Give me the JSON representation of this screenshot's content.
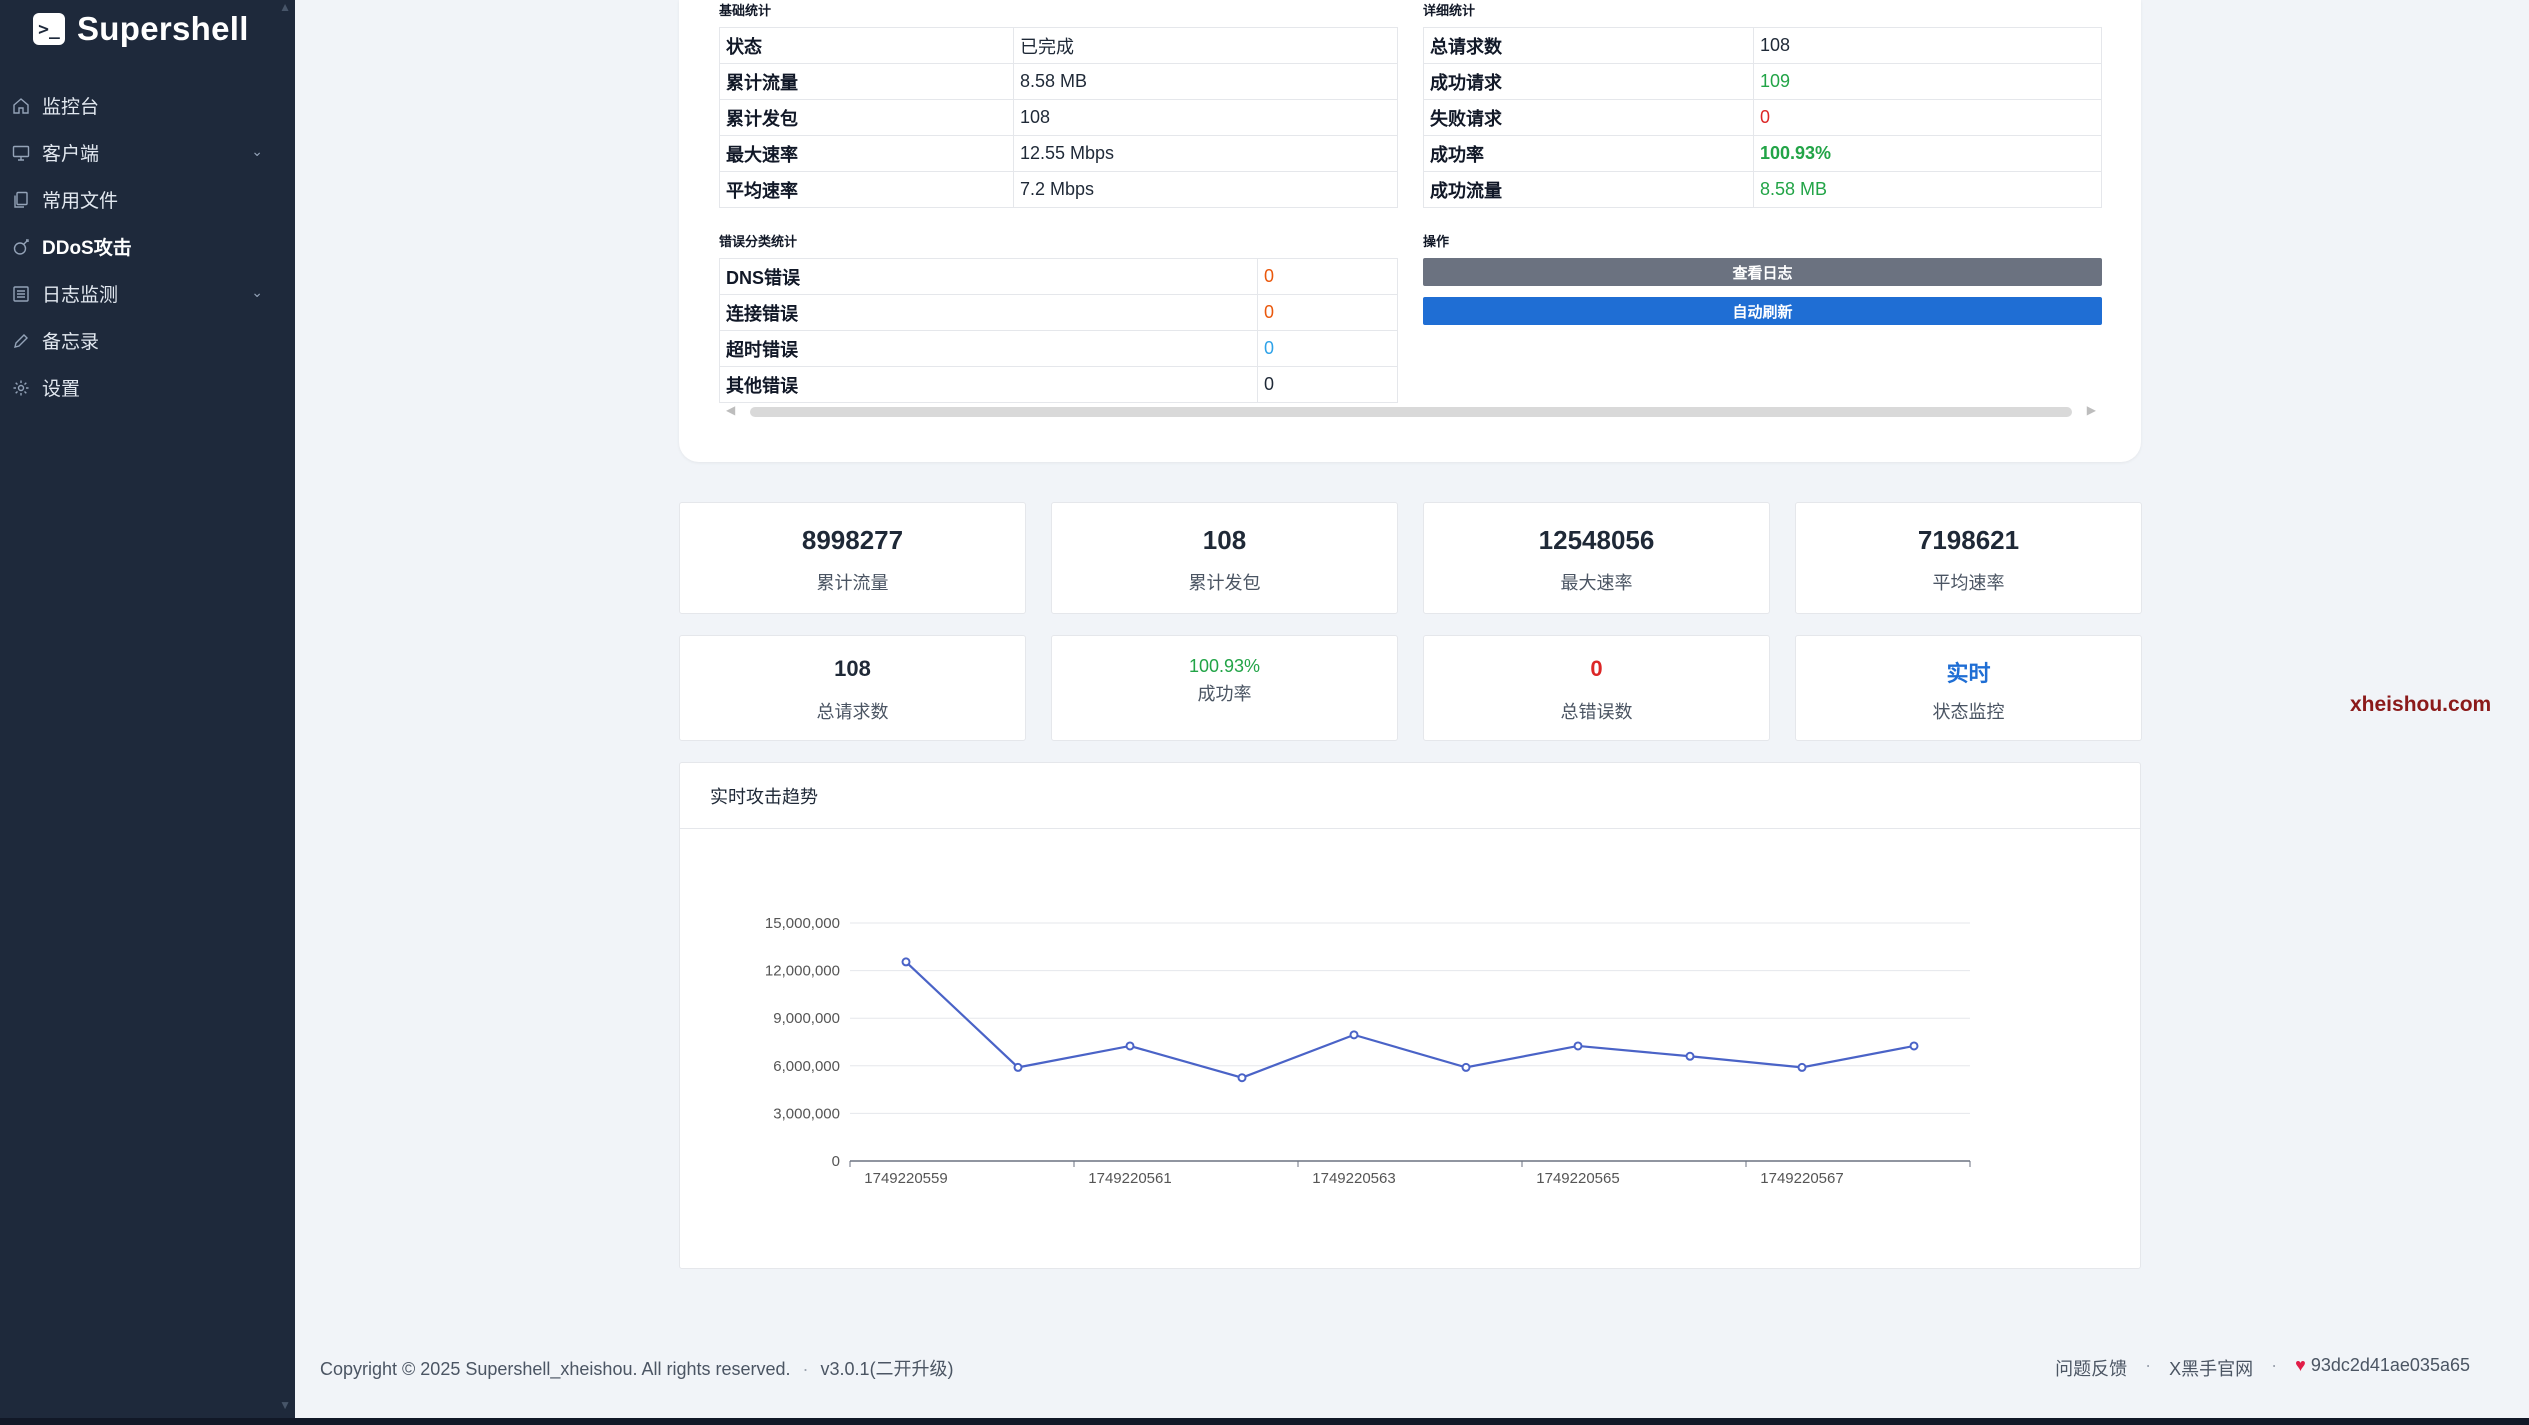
{
  "brand": {
    "name": "Supershell",
    "logo_glyph": ">_"
  },
  "sidebar": {
    "items": [
      {
        "label": "监控台",
        "icon": "home-icon",
        "has_chevron": false,
        "active": false
      },
      {
        "label": "客户端",
        "icon": "monitor-icon",
        "has_chevron": true,
        "active": false
      },
      {
        "label": "常用文件",
        "icon": "files-icon",
        "has_chevron": false,
        "active": false
      },
      {
        "label": "DDoS攻击",
        "icon": "bomb-icon",
        "has_chevron": false,
        "active": true
      },
      {
        "label": "日志监测",
        "icon": "list-icon",
        "has_chevron": true,
        "active": false
      },
      {
        "label": "备忘录",
        "icon": "pencil-icon",
        "has_chevron": false,
        "active": false
      },
      {
        "label": "设置",
        "icon": "gear-icon",
        "has_chevron": false,
        "active": false
      }
    ]
  },
  "basic_stats": {
    "title": "基础统计",
    "rows": [
      {
        "k": "状态",
        "v": "已完成"
      },
      {
        "k": "累计流量",
        "v": "8.58 MB"
      },
      {
        "k": "累计发包",
        "v": "108"
      },
      {
        "k": "最大速率",
        "v": "12.55 Mbps"
      },
      {
        "k": "平均速率",
        "v": "7.2 Mbps"
      }
    ]
  },
  "detail_stats": {
    "title": "详细统计",
    "rows": [
      {
        "k": "总请求数",
        "v": "108"
      },
      {
        "k": "成功请求",
        "v": "109"
      },
      {
        "k": "失败请求",
        "v": "0"
      },
      {
        "k": "成功率",
        "v": "100.93%"
      },
      {
        "k": "成功流量",
        "v": "8.58 MB"
      }
    ]
  },
  "error_stats": {
    "title": "错误分类统计",
    "rows": [
      {
        "k": "DNS错误",
        "v": "0"
      },
      {
        "k": "连接错误",
        "v": "0"
      },
      {
        "k": "超时错误",
        "v": "0"
      },
      {
        "k": "其他错误",
        "v": "0"
      }
    ]
  },
  "actions": {
    "title": "操作",
    "view_log": "查看日志",
    "auto_refresh": "自动刷新",
    "view_log_color": "#6b7280",
    "auto_refresh_color": "#1f6ed4"
  },
  "stat_cards_row1": [
    {
      "value": "8998277",
      "label": "累计流量"
    },
    {
      "value": "108",
      "label": "累计发包"
    },
    {
      "value": "12548056",
      "label": "最大速率"
    },
    {
      "value": "7198621",
      "label": "平均速率"
    }
  ],
  "stat_cards_row2": [
    {
      "value": "108",
      "label": "总请求数"
    },
    {
      "value": "100.93%",
      "label": "成功率"
    },
    {
      "value": "0",
      "label": "总错误数"
    },
    {
      "value": "实时",
      "label": "状态监控"
    }
  ],
  "chart_title": "实时攻击趋势",
  "chart_data": {
    "type": "line",
    "title": "",
    "xlabel": "",
    "ylabel": "",
    "x": [
      1749220559,
      1749220560,
      1749220561,
      1749220562,
      1749220563,
      1749220564,
      1749220565,
      1749220566,
      1749220567,
      1749220568
    ],
    "x_tick_labels": [
      "1749220559",
      "1749220561",
      "1749220563",
      "1749220565",
      "1749220567"
    ],
    "y": [
      12548056,
      5900000,
      7250000,
      5250000,
      7950000,
      5900000,
      7250000,
      6600000,
      5900000,
      7250000
    ],
    "y_ticks": [
      "0",
      "3,000,000",
      "6,000,000",
      "9,000,000",
      "12,000,000",
      "15,000,000"
    ],
    "ylim": [
      0,
      15000000
    ],
    "grid": true,
    "line_color": "#4a63c7"
  },
  "watermark": "xheishou.com",
  "footer": {
    "copyright": "Copyright © 2025 Supershell_xheishou. All rights reserved.",
    "version": "v3.0.1(二开升级)",
    "feedback": "问题反馈",
    "official": "X黑手官网",
    "hash": "93dc2d41ae035a65"
  }
}
